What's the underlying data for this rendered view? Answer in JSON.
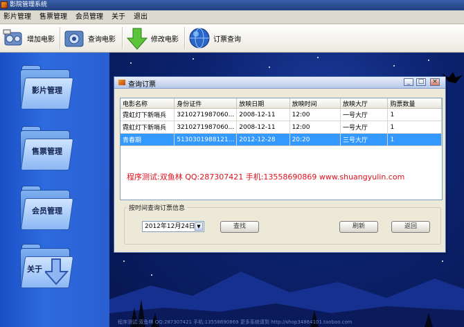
{
  "window": {
    "title": "影院管理系统"
  },
  "menu": [
    "影片管理",
    "售票管理",
    "会员管理",
    "关于",
    "退出"
  ],
  "toolbar": [
    {
      "label": "增加电影",
      "icon": "add-movie-icon"
    },
    {
      "label": "查询电影",
      "icon": "search-movie-icon"
    },
    {
      "label": "修改电影",
      "icon": "edit-movie-icon"
    },
    {
      "label": "订票查询",
      "icon": "globe-icon"
    }
  ],
  "sidebar": [
    {
      "label": "影片管理",
      "icon": "film-folder-icon"
    },
    {
      "label": "售票管理",
      "icon": "ticket-folder-icon"
    },
    {
      "label": "会员管理",
      "icon": "member-folder-icon"
    },
    {
      "label": "关于",
      "icon": "about-folder-icon"
    }
  ],
  "dialog": {
    "title": "查询订票",
    "columns": [
      "电影名称",
      "身份证件",
      "放映日期",
      "放映时间",
      "放映大厅",
      "购票数量"
    ],
    "rows": [
      [
        "霓虹灯下新哨兵",
        "3210271987060...",
        "2008-12-11",
        "12:00",
        "一号大厅",
        "1"
      ],
      [
        "霓虹灯下新哨兵",
        "3210271987060...",
        "2008-12-11",
        "12:00",
        "一号大厅",
        "1"
      ],
      [
        "青春期",
        "5130301988121...",
        "2012-12-28",
        "20:20",
        "三号大厅",
        "1"
      ]
    ],
    "selected_row": 2,
    "notice": "程序测试:双鱼林 QQ:287307421 手机:13558690869 www.shuangyulin.com",
    "group_label": "按时间查询订票信息",
    "date_value": "2012年12月24日",
    "search_button": "查找",
    "refresh_button": "刷新",
    "back_button": "返回"
  },
  "footer_text": "程序测试:双鱼林 QQ:287307421 手机:13558690869 更多系统请到 http://shop34864101.taobao.com",
  "colors": {
    "accent": "#3399ff",
    "notice": "#e0101a",
    "sidebar": "#2d6be0",
    "sky": "#0c2370"
  }
}
